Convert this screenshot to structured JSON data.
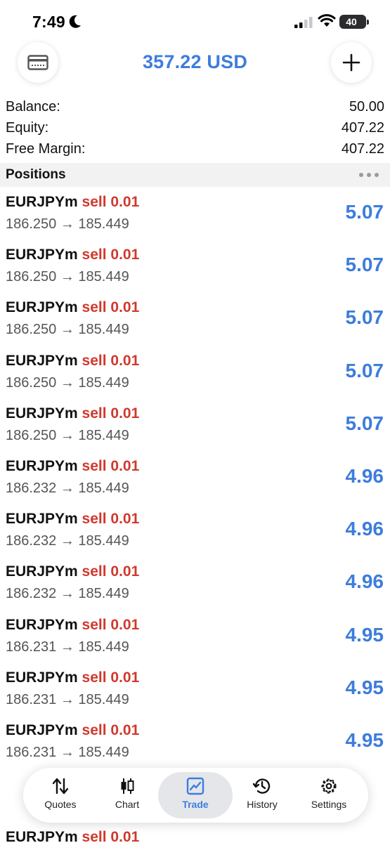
{
  "status_bar": {
    "time": "7:49",
    "battery": "40"
  },
  "header": {
    "title": "357.22 USD"
  },
  "summary": [
    {
      "label": "Balance:",
      "value": "50.00"
    },
    {
      "label": "Equity:",
      "value": "407.22"
    },
    {
      "label": "Free Margin:",
      "value": "407.22"
    }
  ],
  "positions": {
    "title": "Positions",
    "rows": [
      {
        "symbol": "EURJPYm",
        "action": "sell 0.01",
        "prices": "186.250 → 185.449",
        "profit": "5.07"
      },
      {
        "symbol": "EURJPYm",
        "action": "sell 0.01",
        "prices": "186.250 → 185.449",
        "profit": "5.07"
      },
      {
        "symbol": "EURJPYm",
        "action": "sell 0.01",
        "prices": "186.250 → 185.449",
        "profit": "5.07"
      },
      {
        "symbol": "EURJPYm",
        "action": "sell 0.01",
        "prices": "186.250 → 185.449",
        "profit": "5.07"
      },
      {
        "symbol": "EURJPYm",
        "action": "sell 0.01",
        "prices": "186.250 → 185.449",
        "profit": "5.07"
      },
      {
        "symbol": "EURJPYm",
        "action": "sell 0.01",
        "prices": "186.232 → 185.449",
        "profit": "4.96"
      },
      {
        "symbol": "EURJPYm",
        "action": "sell 0.01",
        "prices": "186.232 → 185.449",
        "profit": "4.96"
      },
      {
        "symbol": "EURJPYm",
        "action": "sell 0.01",
        "prices": "186.232 → 185.449",
        "profit": "4.96"
      },
      {
        "symbol": "EURJPYm",
        "action": "sell 0.01",
        "prices": "186.231 → 185.449",
        "profit": "4.95"
      },
      {
        "symbol": "EURJPYm",
        "action": "sell 0.01",
        "prices": "186.231 → 185.449",
        "profit": "4.95"
      },
      {
        "symbol": "EURJPYm",
        "action": "sell 0.01",
        "prices": "186.231 → 185.449",
        "profit": "4.95"
      }
    ],
    "partial_row": {
      "symbol": "EURJPYm",
      "action": "sell 0.01"
    }
  },
  "tab_bar": {
    "tabs": [
      {
        "label": "Quotes",
        "icon": "arrows-up-down-icon"
      },
      {
        "label": "Chart",
        "icon": "candlestick-icon"
      },
      {
        "label": "Trade",
        "icon": "trade-chart-icon",
        "active": true
      },
      {
        "label": "History",
        "icon": "history-icon"
      },
      {
        "label": "Settings",
        "icon": "gear-icon"
      }
    ]
  },
  "colors": {
    "accent": "#3d7ddc",
    "sell": "#d0392c"
  }
}
